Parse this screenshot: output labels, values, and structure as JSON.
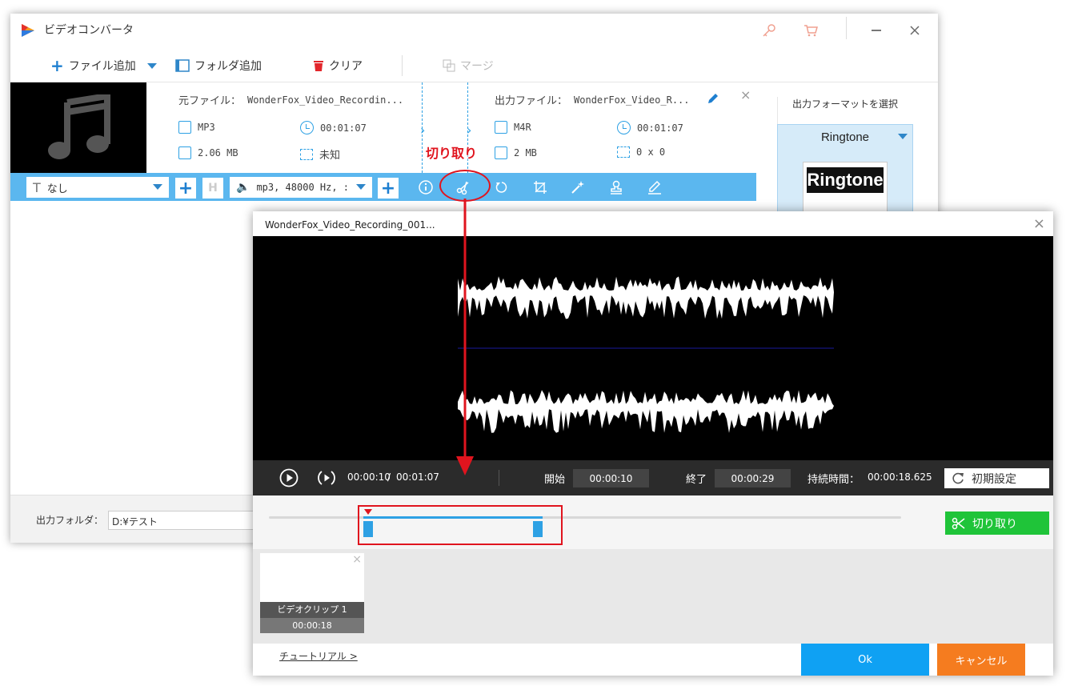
{
  "app": {
    "title": "ビデオコンバータ"
  },
  "toolbar": {
    "add_file_label": "ファイル追加",
    "add_folder_label": "フォルダ追加",
    "clear_label": "クリア",
    "merge_label": "マージ"
  },
  "file_item": {
    "source_label": "元ファイル：",
    "source_name": "WonderFox_Video_Recordin...",
    "source_format": "MP3",
    "source_duration": "00:01:07",
    "source_size": "2.06 MB",
    "source_resolution": "未知",
    "output_label": "出力ファイル：",
    "output_name": "WonderFox_Video_R...",
    "output_format": "M4R",
    "output_duration": "00:01:07",
    "output_size": "2 MB",
    "output_resolution": "0 x 0"
  },
  "settings_bar": {
    "subtitle_value": "なし",
    "audio_value": "mp3, 48000 Hz, :"
  },
  "format_panel": {
    "heading": "出力フォーマットを選択",
    "selected_format": "Ringtone",
    "preview_label": "Ringtone"
  },
  "output_folder": {
    "label": "出力フォルダ：",
    "value": "D:¥テスト"
  },
  "annotation": {
    "cut_label": "切り取り",
    "accent_color": "#e0141e"
  },
  "dialog": {
    "title": "WonderFox_Video_Recording_001...",
    "current_time": "00:00:10",
    "separator": "/",
    "total_time": "00:01:07",
    "start_label": "開始",
    "start_value": "00:00:10",
    "end_label": "終了",
    "end_value": "00:00:29",
    "duration_label": "持続時間：",
    "duration_value": "00:00:18.625",
    "reset_label": "初期設定",
    "cut_button_label": "切り取り",
    "clip_name": "ビデオクリップ 1",
    "clip_duration": "00:00:18",
    "tutorial_link": "チュートリアル >",
    "ok_label": "Ok",
    "cancel_label": "キャンセル",
    "selection_start_fraction": 0.149,
    "selection_end_fraction": 0.433
  },
  "colors": {
    "accent_blue": "#5bb7ef",
    "ok_blue": "#0fa1f3",
    "cancel_orange": "#f57c1f",
    "cut_green": "#1fc439"
  }
}
